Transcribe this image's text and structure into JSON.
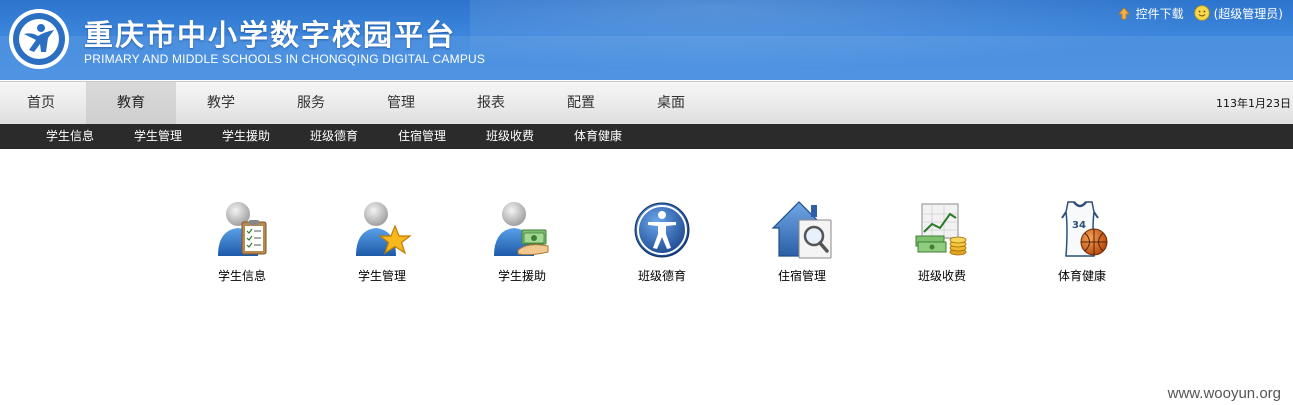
{
  "header": {
    "title_cn": "重庆市中小学数字校园平台",
    "title_en": "PRIMARY AND MIDDLE SCHOOLS IN CHONGQING DIGITAL CAMPUS",
    "download_label": "控件下载",
    "user_label": "(超级管理员)"
  },
  "mainnav": {
    "tabs": [
      {
        "label": "首页"
      },
      {
        "label": "教育",
        "active": true
      },
      {
        "label": "教学"
      },
      {
        "label": "服务"
      },
      {
        "label": "管理"
      },
      {
        "label": "报表"
      },
      {
        "label": "配置"
      },
      {
        "label": "桌面"
      }
    ],
    "date": "113年1月23日"
  },
  "subnav": {
    "items": [
      {
        "label": "学生信息"
      },
      {
        "label": "学生管理"
      },
      {
        "label": "学生援助"
      },
      {
        "label": "班级德育"
      },
      {
        "label": "住宿管理"
      },
      {
        "label": "班级收费"
      },
      {
        "label": "体育健康"
      }
    ]
  },
  "tiles": [
    {
      "label": "学生信息",
      "icon": "student-clipboard-icon"
    },
    {
      "label": "学生管理",
      "icon": "student-star-icon"
    },
    {
      "label": "学生援助",
      "icon": "student-money-icon"
    },
    {
      "label": "班级德育",
      "icon": "accessibility-person-icon"
    },
    {
      "label": "住宿管理",
      "icon": "house-search-icon"
    },
    {
      "label": "班级收费",
      "icon": "money-chart-icon"
    },
    {
      "label": "体育健康",
      "icon": "basketball-jersey-icon"
    }
  ],
  "watermark": "www.wooyun.org",
  "colors": {
    "header_blue": "#3c86dc",
    "subnav_bg": "#2b2b2b",
    "nav_bg": "#eaeaea"
  }
}
